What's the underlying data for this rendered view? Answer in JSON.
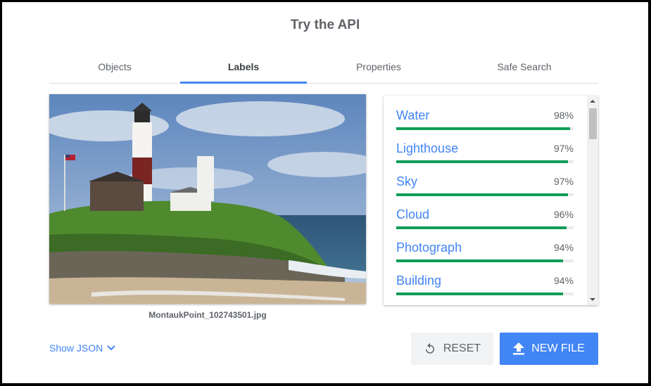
{
  "header": {
    "title": "Try the API"
  },
  "tabs": [
    {
      "label": "Objects",
      "active": false
    },
    {
      "label": "Labels",
      "active": true
    },
    {
      "label": "Properties",
      "active": false
    },
    {
      "label": "Safe Search",
      "active": false
    }
  ],
  "image": {
    "filename": "MontaukPoint_102743501.jpg"
  },
  "labels": [
    {
      "name": "Water",
      "score": "98%",
      "value": 0.98
    },
    {
      "name": "Lighthouse",
      "score": "97%",
      "value": 0.97
    },
    {
      "name": "Sky",
      "score": "97%",
      "value": 0.97
    },
    {
      "name": "Cloud",
      "score": "96%",
      "value": 0.96
    },
    {
      "name": "Photograph",
      "score": "94%",
      "value": 0.94
    },
    {
      "name": "Building",
      "score": "94%",
      "value": 0.94
    }
  ],
  "footer": {
    "show_json": "Show JSON",
    "reset_label": "RESET",
    "new_file_label": "NEW FILE"
  },
  "colors": {
    "accent": "#4285f4",
    "score_bar": "#0f9d58",
    "text_muted": "#5f6368"
  },
  "icons": {
    "reset": "reset-icon",
    "upload": "upload-icon",
    "show_json": "chevron-down-icon"
  }
}
